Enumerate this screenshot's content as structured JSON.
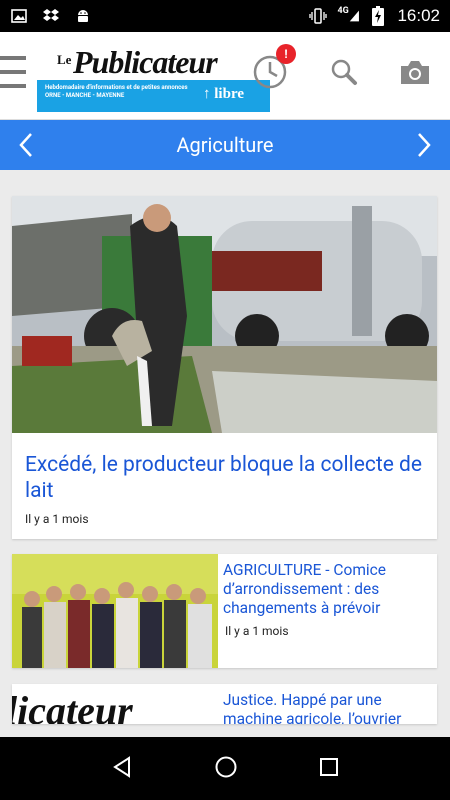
{
  "status_bar": {
    "time": "16:02",
    "network": "4G",
    "icons": [
      "image-icon",
      "dropbox-icon",
      "android-icon",
      "vibrate-icon",
      "signal-icon",
      "battery-charging-icon"
    ]
  },
  "header": {
    "logo_le": "Le",
    "logo_name": "Publicateur",
    "logo_subtitle": "Hebdomadaire d'informations et de petites annonces ORNE - MANCHE - MAYENNE",
    "logo_libre": "↑ libre",
    "notification_count": "!",
    "accent": "#1aa2e4"
  },
  "category_bar": {
    "title": "Agriculture",
    "color": "#2f80ed"
  },
  "articles": [
    {
      "title": "Excédé, le producteur bloque la collecte de lait",
      "time": "Il y a 1 mois"
    },
    {
      "title": "AGRICULTURE - Comice d’arrondissement : des changements à prévoir",
      "time": "Il y a 1 mois"
    },
    {
      "title": "Justice. Happé par une machine agricole, l’ouvrier",
      "time": ""
    }
  ],
  "colors": {
    "link_blue": "#1a56d6",
    "badge_red": "#e8232a"
  }
}
